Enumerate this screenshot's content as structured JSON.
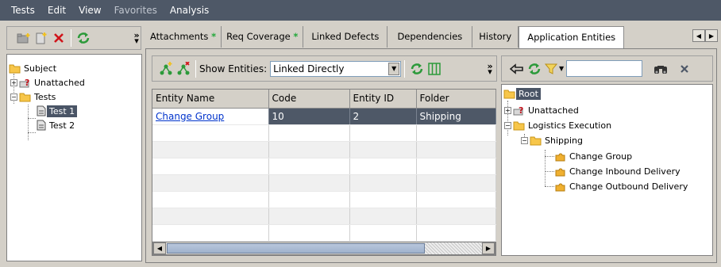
{
  "menu": [
    "Tests",
    "Edit",
    "View",
    "Favorites",
    "Analysis"
  ],
  "left_tree": {
    "root": "Subject",
    "unattached": "Unattached",
    "tests": "Tests",
    "test1": "Test 1",
    "test2": "Test 2"
  },
  "tabs": {
    "attachments": "Attachments",
    "req_coverage": "Req Coverage",
    "linked_defects": "Linked Defects",
    "dependencies": "Dependencies",
    "history": "History",
    "application_entities": "Application Entities",
    "star": "*"
  },
  "entities_toolbar": {
    "show_label": "Show Entities:",
    "show_value": "Linked Directly"
  },
  "grid": {
    "columns": [
      "Entity Name",
      "Code",
      "Entity ID",
      "Folder"
    ],
    "rows": [
      {
        "name": "Change Group",
        "code": "10",
        "id": "2",
        "folder": "Shipping"
      }
    ]
  },
  "right_tree": {
    "root": "Root",
    "unattached": "Unattached",
    "logistics": "Logistics Execution",
    "shipping": "Shipping",
    "change_group": "Change Group",
    "change_inbound": "Change Inbound Delivery",
    "change_outbound": "Change Outbound Delivery"
  },
  "search": {
    "value": ""
  },
  "colors": {
    "menubar": "#4e5867",
    "selection": "#4e5867",
    "star": "#22a83a",
    "link": "#0033cc"
  }
}
